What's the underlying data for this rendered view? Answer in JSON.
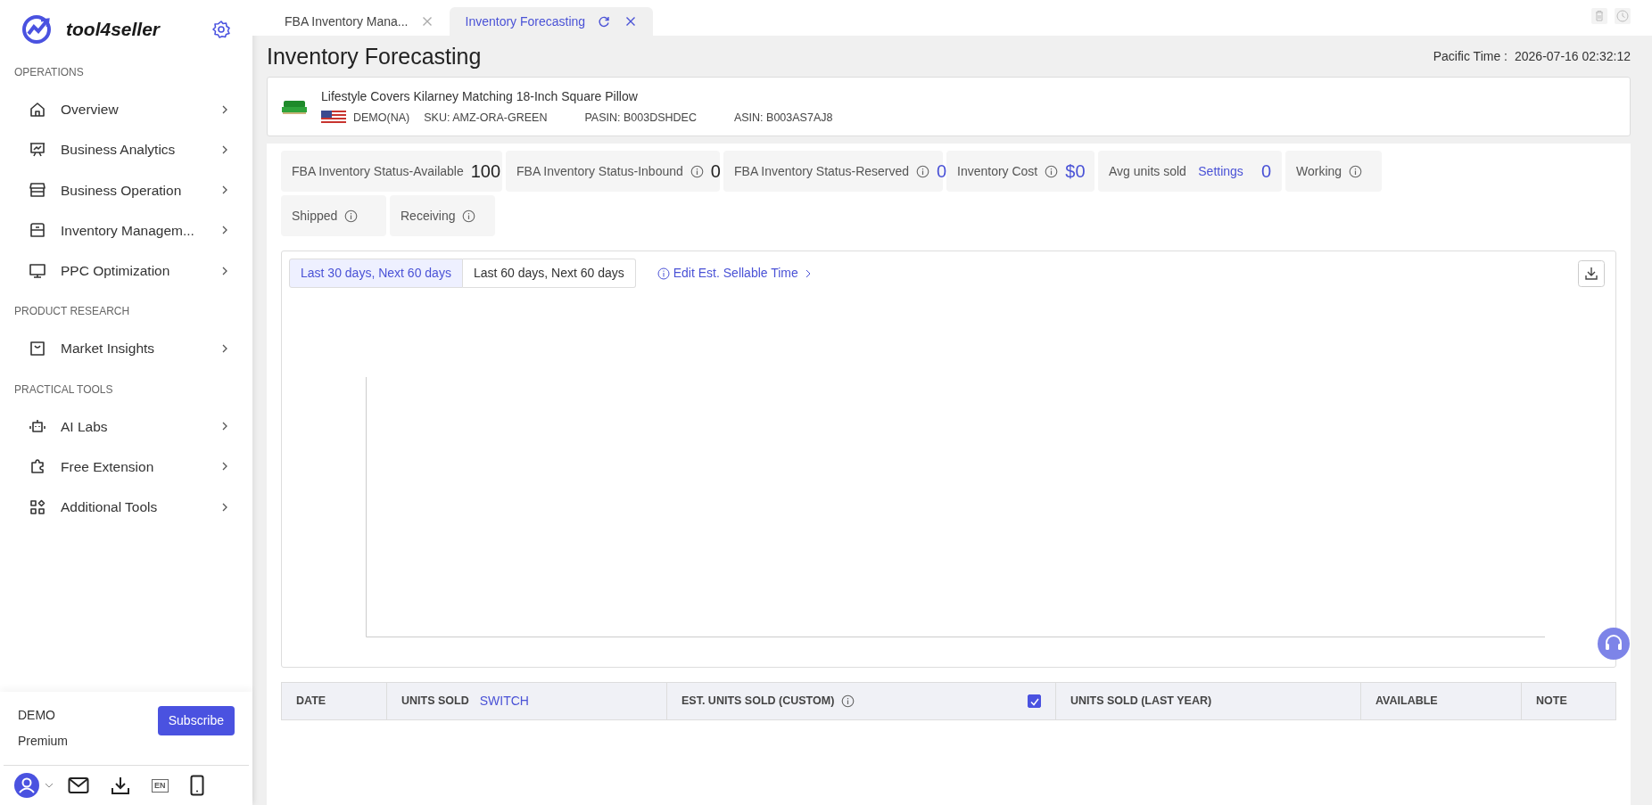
{
  "sidebar": {
    "brand": "tool4seller",
    "sections": [
      {
        "title": "OPERATIONS",
        "items": [
          {
            "label": "Overview"
          },
          {
            "label": "Business Analytics"
          },
          {
            "label": "Business Operation"
          },
          {
            "label": "Inventory Managem..."
          },
          {
            "label": "PPC Optimization"
          }
        ]
      },
      {
        "title": "PRODUCT RESEARCH",
        "items": [
          {
            "label": "Market Insights"
          }
        ]
      },
      {
        "title": "PRACTICAL TOOLS",
        "items": [
          {
            "label": "AI Labs"
          },
          {
            "label": "Free Extension"
          },
          {
            "label": "Additional Tools"
          }
        ]
      }
    ],
    "account": {
      "name": "DEMO",
      "plan": "Premium",
      "button": "Subscribe"
    },
    "language": "EN"
  },
  "tabs": [
    {
      "label": "FBA Inventory Mana...",
      "selected": false
    },
    {
      "label": "Inventory Forecasting",
      "selected": true
    }
  ],
  "page": {
    "title": "Inventory Forecasting",
    "time_label": "Pacific Time :",
    "time_value": "2026-07-16 02:32:12"
  },
  "product": {
    "title": "Lifestyle Covers Kilarney Matching 18-Inch Square Pillow",
    "store": "DEMO(NA)",
    "sku": "SKU: AMZ-ORA-GREEN",
    "pasin": "PASIN: B003DSHDEC",
    "asin": "ASIN: B003AS7AJ8"
  },
  "stats": [
    {
      "label": "FBA Inventory Status-Available",
      "info": false,
      "value": "100",
      "accent": false
    },
    {
      "label": "FBA Inventory Status-Inbound",
      "info": true,
      "value": "0",
      "accent": false
    },
    {
      "label": "FBA Inventory Status-Reserved",
      "info": true,
      "value": "0",
      "accent": true
    },
    {
      "label": "Inventory Cost",
      "info": true,
      "value": "$0",
      "accent": true
    },
    {
      "label": "Avg units sold",
      "info": false,
      "link": "Settings",
      "value": "0",
      "accent": true
    },
    {
      "label": "Working",
      "info": true
    },
    {
      "label": "Shipped",
      "info": true
    },
    {
      "label": "Receiving",
      "info": true
    }
  ],
  "forecast": {
    "ranges": [
      {
        "label": "Last 30 days, Next 60 days",
        "selected": true
      },
      {
        "label": "Last 60 days, Next 60 days",
        "selected": false
      }
    ],
    "edit_link": "Edit Est. Sellable Time"
  },
  "table": {
    "columns": [
      {
        "label": "DATE"
      },
      {
        "label": "UNITS SOLD",
        "link": "SWITCH"
      },
      {
        "label": "EST. UNITS SOLD (CUSTOM)",
        "info": true,
        "checked": true
      },
      {
        "label": "UNITS SOLD (LAST YEAR)"
      },
      {
        "label": "AVAILABLE"
      },
      {
        "label": "NOTE"
      }
    ]
  }
}
